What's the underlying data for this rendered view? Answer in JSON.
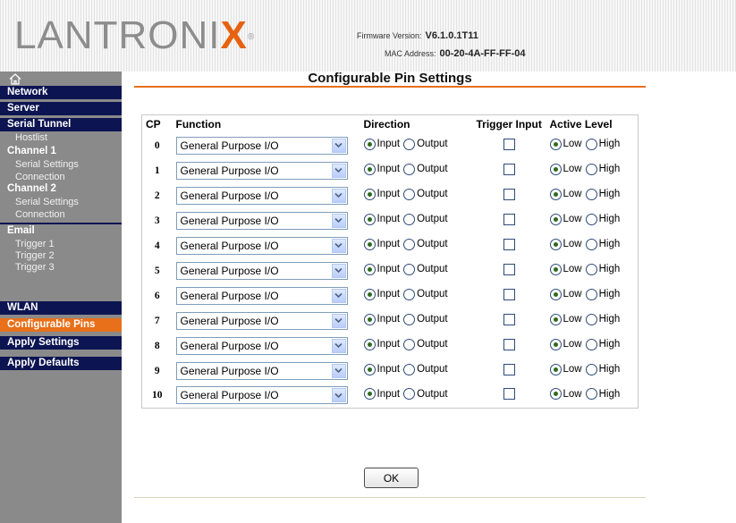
{
  "header": {
    "logo_main": "LANTRONI",
    "logo_accent": "X",
    "logo_mark": "®",
    "firmware_label": "Firmware Version:",
    "firmware_value": "V6.1.0.1T11",
    "mac_label": "MAC Address:",
    "mac_value": "00-20-4A-FF-FF-04"
  },
  "sidebar": {
    "home_icon": "home-icon",
    "items": [
      {
        "label": "Network",
        "kind": "main"
      },
      {
        "label": "Server",
        "kind": "main"
      },
      {
        "label": "Serial Tunnel",
        "kind": "main"
      },
      {
        "label": "Hostlist",
        "kind": "sub"
      },
      {
        "label": "Channel 1",
        "kind": "main"
      },
      {
        "label": "Serial Settings",
        "kind": "sub"
      },
      {
        "label": "Connection",
        "kind": "sub"
      },
      {
        "label": "Channel 2",
        "kind": "main"
      },
      {
        "label": "Serial Settings",
        "kind": "sub"
      },
      {
        "label": "Connection",
        "kind": "sub"
      },
      {
        "label": "Email",
        "kind": "main"
      },
      {
        "label": "Trigger 1",
        "kind": "sub"
      },
      {
        "label": "Trigger 2",
        "kind": "sub"
      },
      {
        "label": "Trigger 3",
        "kind": "sub"
      },
      {
        "label": "WLAN",
        "kind": "main"
      },
      {
        "label": "Configurable Pins",
        "kind": "main",
        "active": true
      },
      {
        "label": "Apply Settings",
        "kind": "main"
      },
      {
        "label": "Apply Defaults",
        "kind": "main"
      }
    ],
    "active_color": "#e8701a",
    "band_color": "#0d1452"
  },
  "main": {
    "title": "Configurable Pin Settings",
    "columns": [
      "CP",
      "Function",
      "Direction",
      "Trigger Input",
      "Active Level"
    ],
    "direction_options": [
      "Input",
      "Output"
    ],
    "level_options": [
      "Low",
      "High"
    ],
    "rows": [
      {
        "cp": "0",
        "function": "General Purpose I/O",
        "direction": "Input",
        "trigger": false,
        "level": "Low"
      },
      {
        "cp": "1",
        "function": "General Purpose I/O",
        "direction": "Input",
        "trigger": false,
        "level": "Low"
      },
      {
        "cp": "2",
        "function": "General Purpose I/O",
        "direction": "Input",
        "trigger": false,
        "level": "Low"
      },
      {
        "cp": "3",
        "function": "General Purpose I/O",
        "direction": "Input",
        "trigger": false,
        "level": "Low"
      },
      {
        "cp": "4",
        "function": "General Purpose I/O",
        "direction": "Input",
        "trigger": false,
        "level": "Low"
      },
      {
        "cp": "5",
        "function": "General Purpose I/O",
        "direction": "Input",
        "trigger": false,
        "level": "Low"
      },
      {
        "cp": "6",
        "function": "General Purpose I/O",
        "direction": "Input",
        "trigger": false,
        "level": "Low"
      },
      {
        "cp": "7",
        "function": "General Purpose I/O",
        "direction": "Input",
        "trigger": false,
        "level": "Low"
      },
      {
        "cp": "8",
        "function": "General Purpose I/O",
        "direction": "Input",
        "trigger": false,
        "level": "Low"
      },
      {
        "cp": "9",
        "function": "General Purpose I/O",
        "direction": "Input",
        "trigger": false,
        "level": "Low"
      },
      {
        "cp": "10",
        "function": "General Purpose I/O",
        "direction": "Input",
        "trigger": false,
        "level": "Low"
      }
    ],
    "ok_label": "OK",
    "accent_color": "#e8701a"
  }
}
